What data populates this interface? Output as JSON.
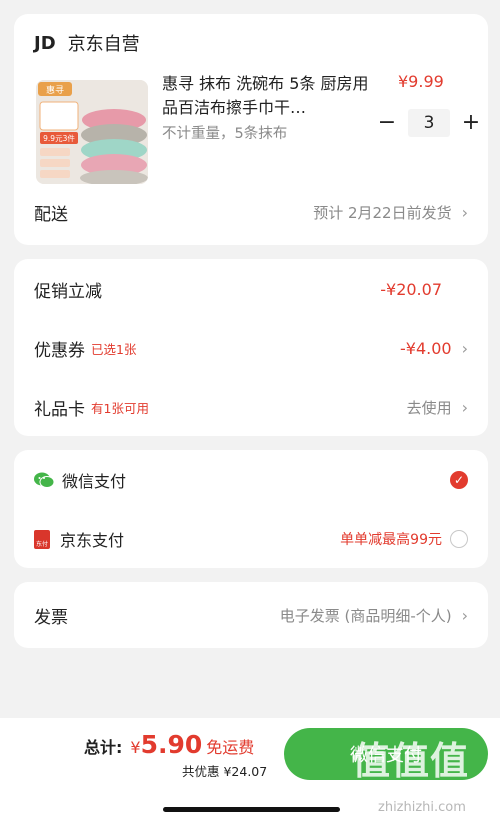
{
  "store": {
    "logo": "JD",
    "name": "京东自营"
  },
  "product": {
    "image_brand": "惠寻",
    "image_promo": "9.9元3件",
    "title": "惠寻  抹布 洗碗布 5条 厨房用品百洁布擦手巾干…",
    "price": "¥9.99",
    "spec": "不计重量，5条抹布",
    "quantity": "3",
    "minus": "−",
    "plus": "+"
  },
  "delivery": {
    "label": "配送",
    "value": "预计 2月22日前发货"
  },
  "discounts": {
    "promo": {
      "label": "促销立减",
      "value": "-¥20.07"
    },
    "coupon": {
      "label": "优惠券",
      "tag": "已选1张",
      "value": "-¥4.00"
    },
    "giftcard": {
      "label": "礼品卡",
      "tag": "有1张可用",
      "value": "去使用"
    }
  },
  "payment": {
    "wechat": {
      "label": "微信支付",
      "selected": true
    },
    "jd": {
      "label": "京东支付",
      "promo": "单单减最高99元",
      "icon_text": "东付",
      "selected": false
    }
  },
  "invoice": {
    "label": "发票",
    "value": "电子发票 (商品明细-个人)"
  },
  "footer": {
    "total_label": "总计:",
    "currency": "¥",
    "total": "5.90",
    "shipping": "免运费",
    "saved": "共优惠 ¥24.07",
    "pay_button": "微信支付"
  },
  "watermark": {
    "brand": "值值值",
    "url": "zhizhizhi.com"
  },
  "colors": {
    "accent_red": "#e23b2e",
    "wechat_green": "#44b549"
  }
}
